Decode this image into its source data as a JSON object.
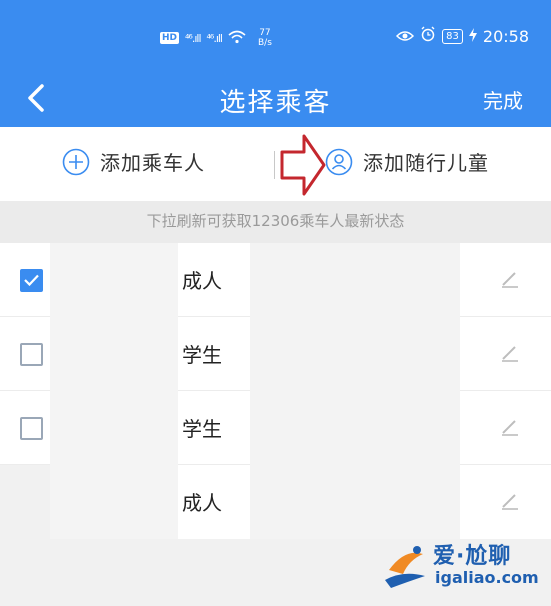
{
  "status_bar": {
    "hd_badge": "HD",
    "signal_1": "⁴⁶.ıll",
    "signal_2": "⁴⁶.ıll",
    "speed_value": "77",
    "speed_unit": "B/s",
    "battery": "83",
    "time": "20:58"
  },
  "nav": {
    "title": "选择乘客",
    "done_label": "完成"
  },
  "actions": {
    "add_passenger": "添加乘车人",
    "add_child": "添加随行儿童"
  },
  "hint": "下拉刷新可获取12306乘车人最新状态",
  "passengers": [
    {
      "type": "成人",
      "checked": true
    },
    {
      "type": "学生",
      "checked": false
    },
    {
      "type": "学生",
      "checked": false
    },
    {
      "type": "成人",
      "checked": false
    }
  ],
  "watermark": {
    "cn": "爱·尬聊",
    "url": "igaliao.com"
  },
  "colors": {
    "primary": "#3a8cf0",
    "arrow": "#c4272e"
  }
}
